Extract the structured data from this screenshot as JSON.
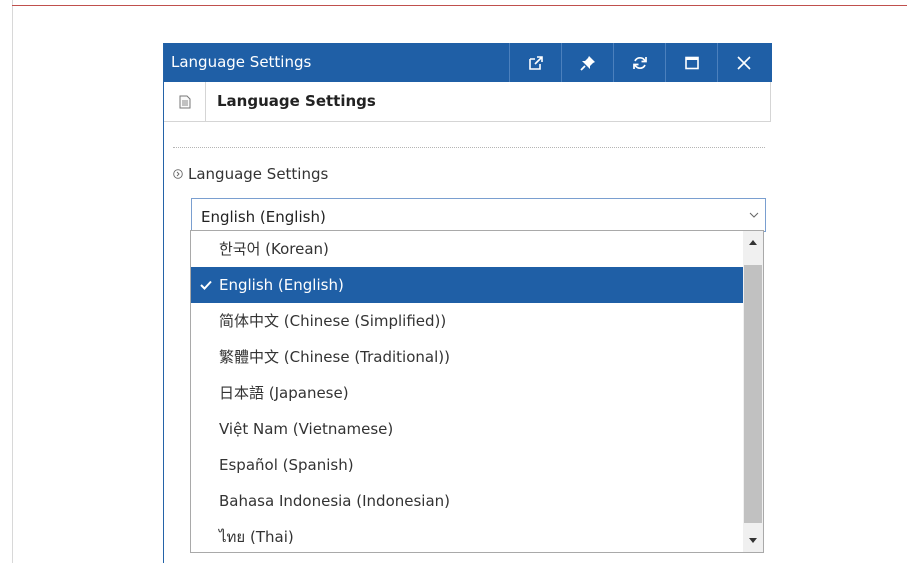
{
  "window": {
    "title": "Language Settings",
    "buttons": {
      "popout": "external-link-icon",
      "pin": "pin-icon",
      "refresh": "refresh-icon",
      "maximize": "maximize-icon",
      "close": "close-icon"
    }
  },
  "subheader": {
    "title": "Language Settings"
  },
  "section": {
    "label": "Language Settings"
  },
  "select": {
    "value": "English (English)"
  },
  "dropdown": {
    "selected_index": 1,
    "options": [
      "한국어 (Korean)",
      "English (English)",
      "简体中文 (Chinese (Simplified))",
      "繁體中文 (Chinese (Traditional))",
      "日本語 (Japanese)",
      "Việt Nam (Vietnamese)",
      "Español (Spanish)",
      "Bahasa Indonesia (Indonesian)",
      "ไทย (Thai)"
    ]
  },
  "colors": {
    "titlebar": "#1f5fa6",
    "selected": "#1f5fa6",
    "accent_rule": "#c0504d"
  }
}
